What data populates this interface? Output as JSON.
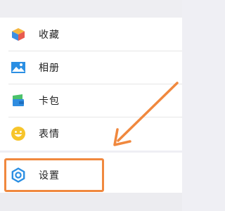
{
  "menu": {
    "items": [
      {
        "label": "收藏",
        "icon": "favorites-cube-icon"
      },
      {
        "label": "相册",
        "icon": "album-picture-icon"
      },
      {
        "label": "卡包",
        "icon": "card-wallet-icon"
      },
      {
        "label": "表情",
        "icon": "emoji-smile-icon"
      }
    ],
    "settings": {
      "label": "设置",
      "icon": "gear-icon"
    }
  },
  "annotation": {
    "color": "#f0883e"
  }
}
